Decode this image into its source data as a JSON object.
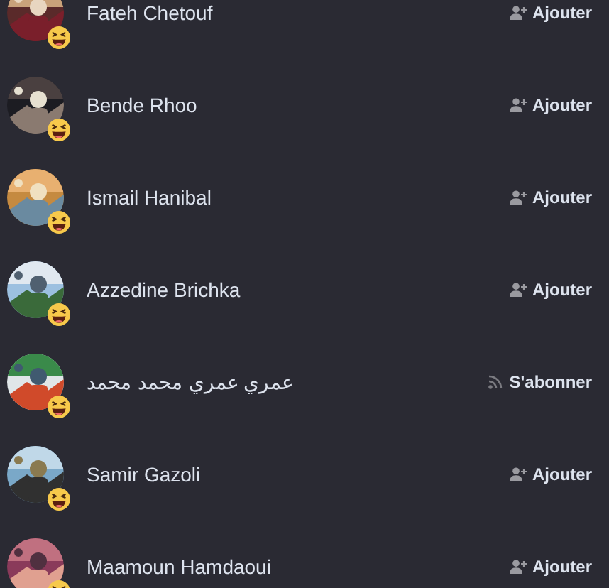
{
  "people": [
    {
      "name": "Fateh Chetouf",
      "action": {
        "kind": "add",
        "label": "Ajouter"
      }
    },
    {
      "name": "Bende Rhoo",
      "action": {
        "kind": "add",
        "label": "Ajouter"
      }
    },
    {
      "name": "Ismail Hanibal",
      "action": {
        "kind": "add",
        "label": "Ajouter"
      }
    },
    {
      "name": "Azzedine Brichka",
      "action": {
        "kind": "add",
        "label": "Ajouter"
      }
    },
    {
      "name": "عمري عمري محمد محمد",
      "action": {
        "kind": "follow",
        "label": "S'abonner"
      }
    },
    {
      "name": "Samir Gazoli",
      "action": {
        "kind": "add",
        "label": "Ajouter"
      }
    },
    {
      "name": "Maamoun Hamdaoui",
      "action": {
        "kind": "add",
        "label": "Ajouter"
      }
    }
  ]
}
